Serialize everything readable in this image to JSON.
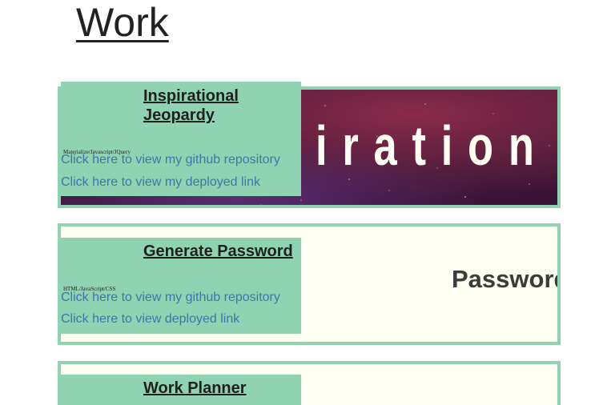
{
  "page": {
    "section_title": "Work"
  },
  "projects": [
    {
      "title": "Inspirational Jeopardy",
      "tech": "Materialize/Javascript/JQuery",
      "github_link": "Click here to view my github repository",
      "deployed_link": "Click here to view my deployed link",
      "thumbnail_text": "iration",
      "thumbnail_colors": {
        "base": "#5b1f3d",
        "accent": "#8a2a4a",
        "text": "#fffdf2"
      }
    },
    {
      "title": "Generate Password",
      "tech": "HTML/JavaScript/CSS",
      "github_link": "Click here to view my github repository",
      "deployed_link": "Click here to view deployed link",
      "thumbnail_text": "Password",
      "thumbnail_colors": {
        "base": "#fffff2",
        "text": "#3b3b3b"
      }
    },
    {
      "title": "Work Planner",
      "thumbnail_colors": {
        "base": "#fffff2"
      }
    }
  ],
  "colors": {
    "card_border": "#8fd3b2",
    "info_panel": "#8fd3b2",
    "link": "#3a78a8",
    "heading": "#222222"
  }
}
